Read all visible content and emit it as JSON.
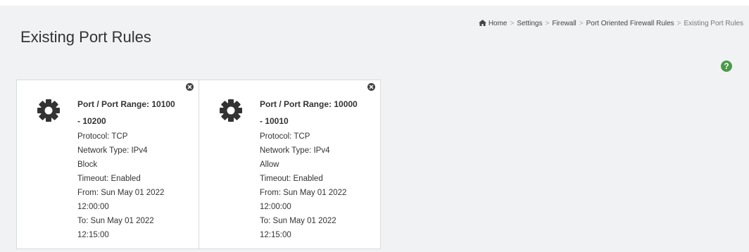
{
  "page": {
    "title": "Existing Port Rules"
  },
  "breadcrumb": {
    "items": [
      "Home",
      "Settings",
      "Firewall",
      "Port Oriented Firewall Rules"
    ],
    "active": "Existing Port Rules"
  },
  "colors": {
    "help": "#4a9a4a",
    "background": "#f1f2f4"
  },
  "rules": [
    {
      "title_line1": "Port / Port Range: 10100",
      "title_line2": "- 10200",
      "protocol": "Protocol: TCP",
      "network_type": "Network Type: IPv4",
      "action": "Block",
      "timeout": "Timeout: Enabled",
      "from_date": "From: Sun May 01 2022",
      "from_time": "12:00:00",
      "to_date": "To: Sun May 01 2022",
      "to_time": "12:15:00"
    },
    {
      "title_line1": "Port / Port Range: 10000",
      "title_line2": "- 10010",
      "protocol": "Protocol: TCP",
      "network_type": "Network Type: IPv4",
      "action": "Allow",
      "timeout": "Timeout: Enabled",
      "from_date": "From: Sun May 01 2022",
      "from_time": "12:00:00",
      "to_date": "To: Sun May 01 2022",
      "to_time": "12:15:00"
    }
  ]
}
